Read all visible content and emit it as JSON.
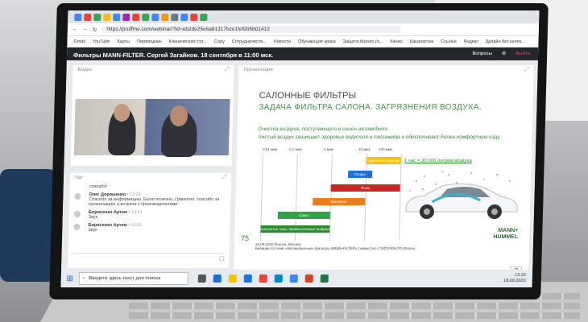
{
  "browser": {
    "url": "https://pruffme.com/webinar/?id=eb2de25e6a91317bce1fef005b01413",
    "bookmarks": [
      "Gmail",
      "YouTube",
      "Карты",
      "Переводчик",
      "Клиническая стр...",
      "Copy",
      "Сотрудничеств...",
      "Новости",
      "Обучающие уроки",
      "Защита бизнес (п...",
      "Канал",
      "Каналистик",
      "Ссылки",
      "Яндекс",
      "Дизайн без кнопк..."
    ]
  },
  "app": {
    "title": "Фильтры MANN-FILTER. Сергей Загайнов. 18 сентября в 11:00 мск.",
    "questions_label": "Вопросы",
    "exit_label": "Выйти"
  },
  "video_panel": {
    "label": "Видео"
  },
  "chat_panel": {
    "label": "Чат",
    "messages": [
      {
        "name": "",
        "time": "",
        "text": "спасибо!"
      },
      {
        "name": "Олег Дорошенко",
        "time": "• 13:21",
        "text": "Спасибо за информацию. Было полезно. Грамотно, спасибо за организацию и встречи с производителями"
      },
      {
        "name": "Борисенко Артем",
        "time": "• 13:21",
        "text": "Звук"
      },
      {
        "name": "Борисенко Артем",
        "time": "• 13:21",
        "text": "Звук"
      }
    ]
  },
  "presentation_panel": {
    "label": "Презентация",
    "page_indicator": "75"
  },
  "slide": {
    "title_line1": "САЛОННЫЕ ФИЛЬТРЫ",
    "title_line2": "ЗАДАЧА ФИЛЬТРА САЛОНА. ЗАГРЯЗНЕНИЯ ВОЗДУХА.",
    "subtitle1": "Очистка воздуха, поступающего в салон автомобиля.",
    "subtitle2": "Чистый воздух защищает здоровье водителя и пассажира и обеспечивает более комфортную езду.",
    "car_caption": "1 час = 30 000 литров воздуха",
    "slide_number": "75",
    "footer_line1": "16.09.2020 Россия, Москва",
    "footer_line2": "Вебинар по теме «Автомобильные фильтры MANN-FILTER» совместно с GROUPAUTO Russia",
    "brand_line1": "MANN+",
    "brand_line2": "HUMMEL"
  },
  "chart_data": {
    "type": "bar",
    "xscale": "log",
    "xunit": "мкм",
    "ticks": [
      "0,01 мкм",
      "0,1 мкм",
      "1 мкм",
      "10 мкм",
      "100 мкм"
    ],
    "bars": [
      {
        "label": "Цветочная пыльца",
        "range": [
          10,
          100
        ],
        "color": "#f2c200"
      },
      {
        "label": "Споры",
        "range": [
          3,
          15
        ],
        "color": "#1f6fd0"
      },
      {
        "label": "Пыль",
        "range": [
          1,
          100
        ],
        "color": "#d02525"
      },
      {
        "label": "Бактерии",
        "range": [
          0.3,
          10
        ],
        "color": "#ef7d1a"
      },
      {
        "label": "Сажа",
        "range": [
          0.03,
          1
        ],
        "color": "#2ea34a"
      },
      {
        "label": "Выхлопные газы, промышленные выбросы",
        "range": [
          0.01,
          1
        ],
        "color": "#2e8a2e"
      }
    ]
  },
  "taskbar": {
    "search_placeholder": "Введите здесь текст для поиска",
    "time": "13:22",
    "date": "18.09.2020"
  },
  "colors": {
    "accent_green": "#3c9a3c",
    "appbar": "#23262a"
  }
}
